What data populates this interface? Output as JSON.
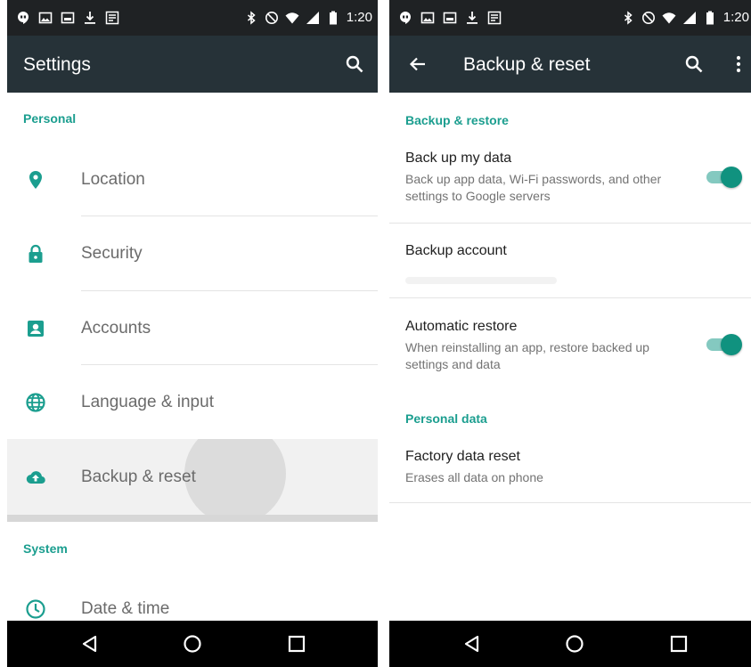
{
  "left": {
    "status_time": "1:20",
    "appbar_title": "Settings",
    "section_personal": "Personal",
    "items": [
      {
        "label": "Location",
        "icon": "location-pin-icon"
      },
      {
        "label": "Security",
        "icon": "lock-icon"
      },
      {
        "label": "Accounts",
        "icon": "account-box-icon"
      },
      {
        "label": "Language & input",
        "icon": "globe-icon"
      },
      {
        "label": "Backup & reset",
        "icon": "cloud-upload-icon"
      }
    ],
    "section_system": "System",
    "system_items": [
      {
        "label": "Date & time",
        "icon": "clock-icon"
      }
    ]
  },
  "right": {
    "status_time": "1:20",
    "appbar_title": "Backup & reset",
    "section_backup": "Backup & restore",
    "back_up_title": "Back up my data",
    "back_up_sub": "Back up app data, Wi-Fi passwords, and other settings to Google servers",
    "back_up_enabled": true,
    "backup_account_title": "Backup account",
    "auto_restore_title": "Automatic restore",
    "auto_restore_sub": "When reinstalling an app, restore backed up settings and data",
    "auto_restore_enabled": true,
    "section_personal_data": "Personal data",
    "factory_title": "Factory data reset",
    "factory_sub": "Erases all data on phone"
  },
  "colors": {
    "accent": "#1b9e8f",
    "appbar": "#263238",
    "statusbar": "#1f2224",
    "toggle_thumb": "#10927f",
    "toggle_track": "#84c9c0",
    "navbar": "#000000"
  }
}
